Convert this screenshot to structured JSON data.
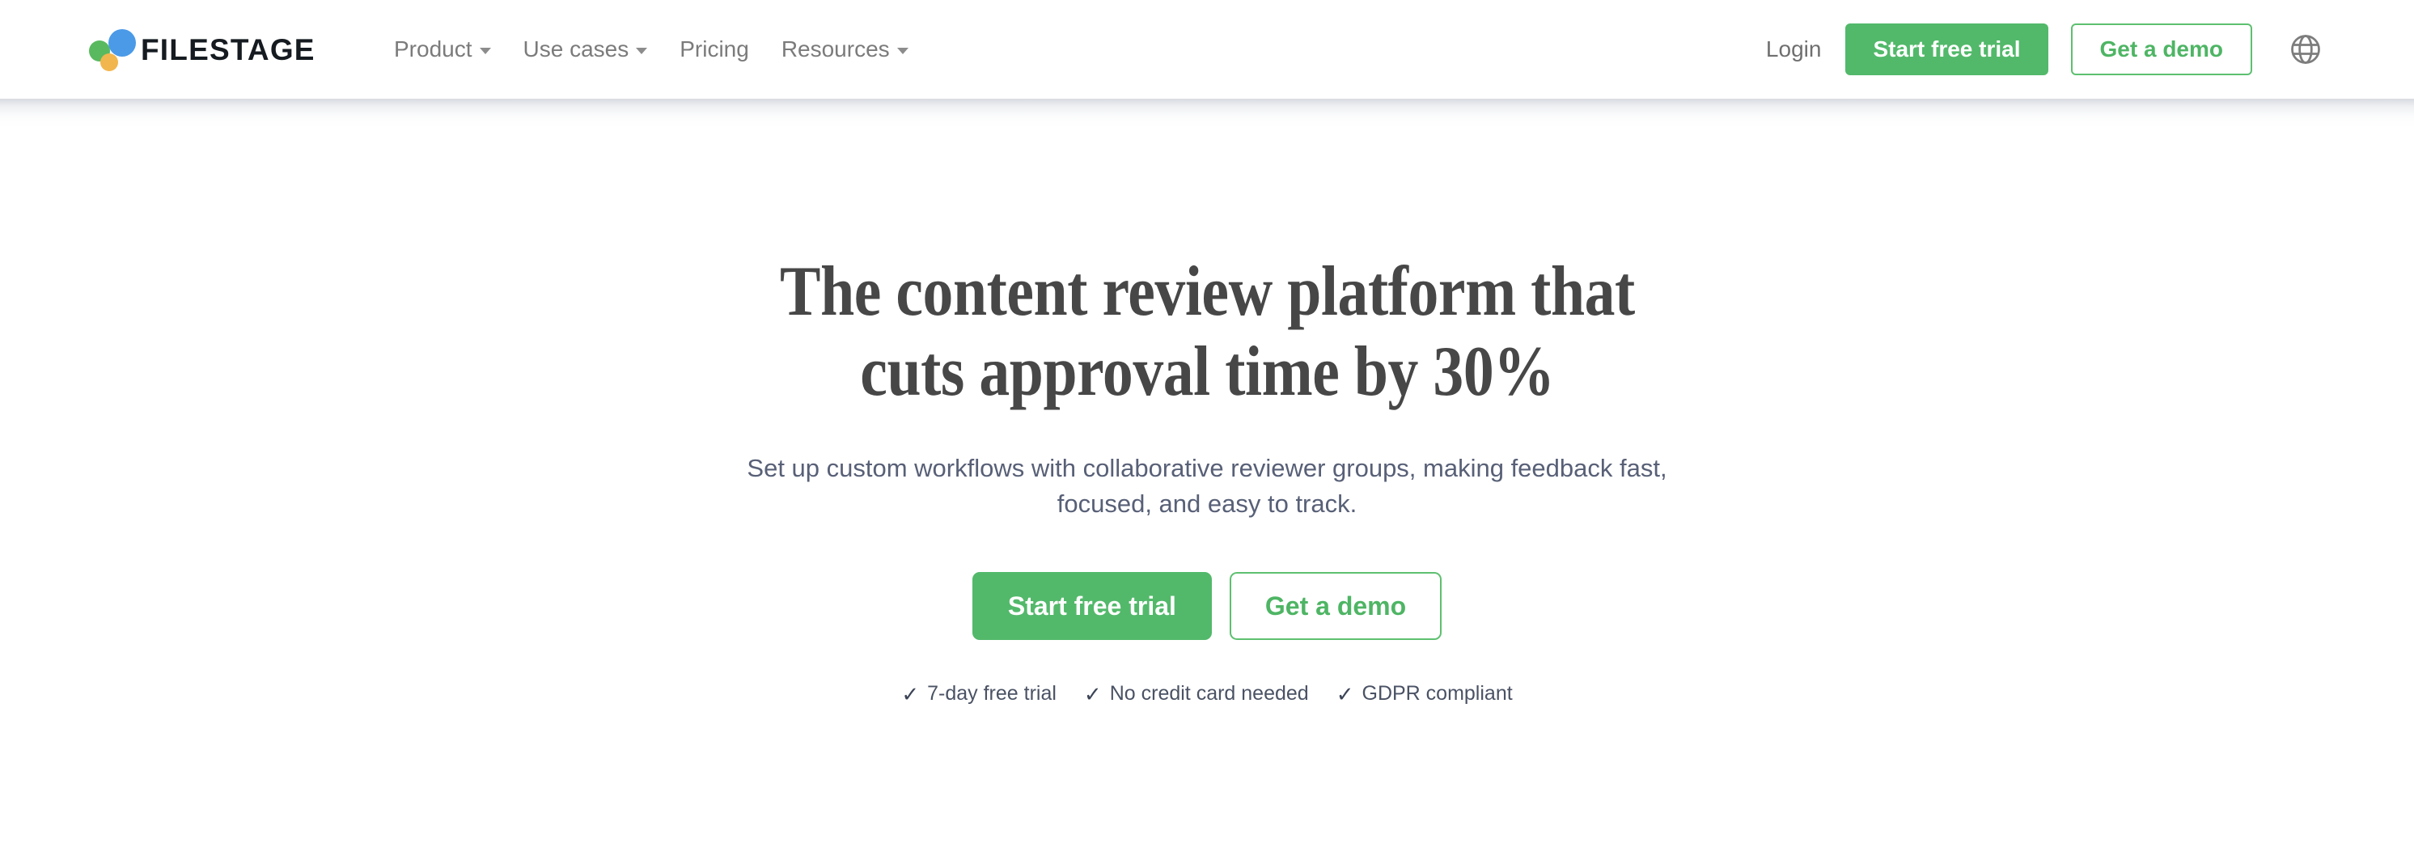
{
  "brand": {
    "name": "FILESTAGE",
    "logo_dots": [
      "green-dot",
      "blue-dot",
      "yellow-dot"
    ],
    "colors": {
      "green": "#52b96a",
      "logo_green": "#59b95f",
      "logo_blue": "#4a9ae8",
      "logo_yellow": "#f2b64e",
      "wordmark": "#151b20",
      "nav_text": "#7b7b7b",
      "headline": "#474747",
      "subtext": "#586077"
    }
  },
  "header": {
    "nav": [
      {
        "label": "Product",
        "has_dropdown": true
      },
      {
        "label": "Use cases",
        "has_dropdown": true
      },
      {
        "label": "Pricing",
        "has_dropdown": false
      },
      {
        "label": "Resources",
        "has_dropdown": true
      }
    ],
    "login_label": "Login",
    "start_trial_label": "Start free trial",
    "get_demo_label": "Get a demo",
    "language_icon": "globe-icon"
  },
  "hero": {
    "title_line_1": "The content review platform that",
    "title_line_2": "cuts approval time by 30%",
    "subtitle": "Set up custom workflows with collaborative reviewer groups, making feedback fast, focused, and easy to track.",
    "primary_cta": "Start free trial",
    "secondary_cta": "Get a demo",
    "trust_badges": [
      {
        "check": "✓",
        "label": "7-day free trial"
      },
      {
        "check": "✓",
        "label": "No credit card needed"
      },
      {
        "check": "✓",
        "label": "GDPR compliant"
      }
    ]
  }
}
